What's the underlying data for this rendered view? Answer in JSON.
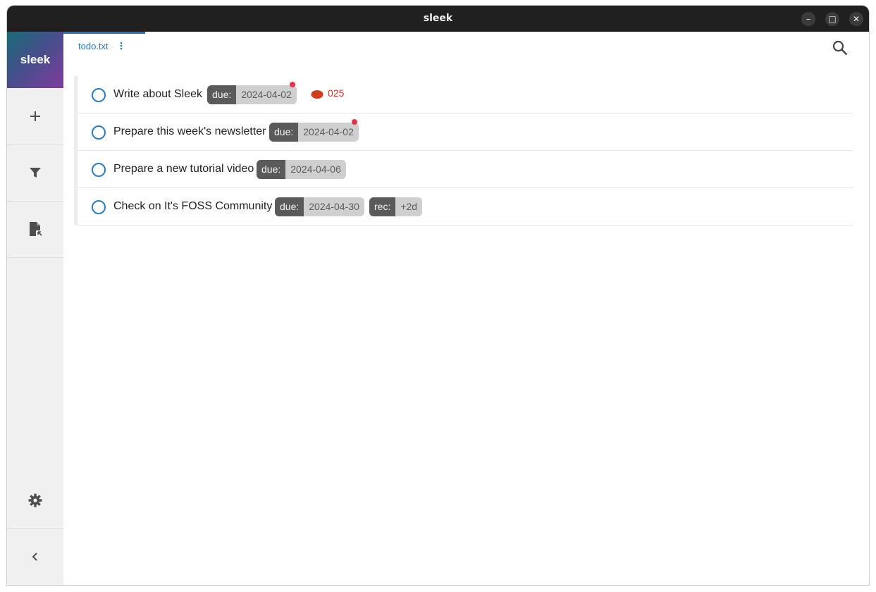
{
  "window": {
    "title": "sleek",
    "buttons": [
      "–",
      "□",
      "✕"
    ]
  },
  "sidebar": {
    "logo": "sleek",
    "items": [
      {
        "name": "add",
        "icon": "plus-icon"
      },
      {
        "name": "filter",
        "icon": "filter-icon"
      },
      {
        "name": "file",
        "icon": "file-import-icon"
      }
    ],
    "bottom": [
      {
        "name": "settings",
        "icon": "gear-icon"
      },
      {
        "name": "collapse",
        "icon": "chevron-left-icon"
      }
    ]
  },
  "tabs": [
    {
      "label": "todo.txt"
    }
  ],
  "search": {
    "icon": "search-icon"
  },
  "todos": [
    {
      "text": "Write about Sleek",
      "due_label": "due:",
      "due": "2024-04-02",
      "overdue": true,
      "pomodoro": "025"
    },
    {
      "text": "Prepare this week's newsletter",
      "due_label": "due:",
      "due": "2024-04-02",
      "overdue": true
    },
    {
      "text": "Prepare a new tutorial video",
      "due_label": "due:",
      "due": "2024-04-06"
    },
    {
      "text": "Check on It's FOSS Community",
      "due_label": "due:",
      "due": "2024-04-30",
      "rec_label": "rec:",
      "rec": "+2d"
    }
  ],
  "colors": {
    "accent": "#1f76c8",
    "overdue_dot": "#e8334a",
    "pomodoro": "#c8381e"
  }
}
